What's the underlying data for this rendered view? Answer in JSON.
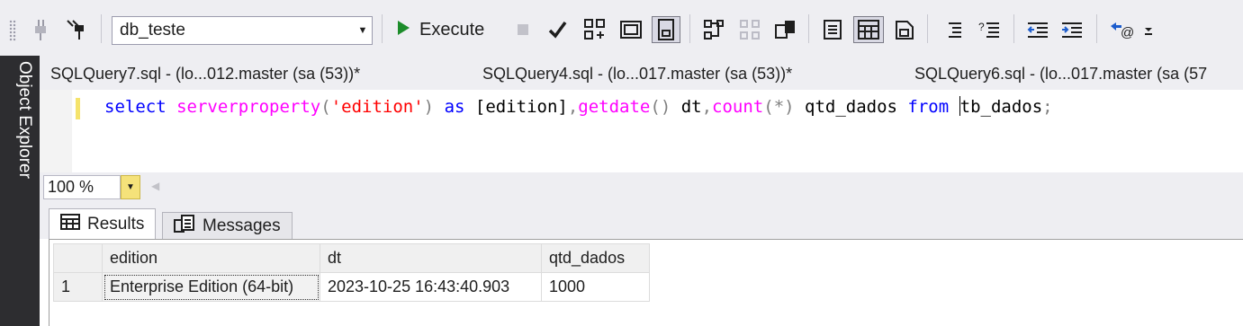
{
  "toolbar": {
    "database": "db_teste",
    "execute_label": "Execute"
  },
  "object_explorer": {
    "label": "Object Explorer"
  },
  "doc_tabs": [
    {
      "label": "SQLQuery7.sql - (lo...012.master (sa (53))*"
    },
    {
      "label": "SQLQuery4.sql - (lo...017.master (sa (53))*"
    },
    {
      "label": "SQLQuery6.sql - (lo...017.master (sa (57"
    }
  ],
  "editor": {
    "tokens": [
      {
        "t": "select",
        "c": "kw"
      },
      {
        "t": " ",
        "c": ""
      },
      {
        "t": "serverproperty",
        "c": "fn"
      },
      {
        "t": "(",
        "c": "op"
      },
      {
        "t": "'edition'",
        "c": "str"
      },
      {
        "t": ")",
        "c": "op"
      },
      {
        "t": " ",
        "c": ""
      },
      {
        "t": "as",
        "c": "kw"
      },
      {
        "t": " [edition]",
        "c": ""
      },
      {
        "t": ",",
        "c": "op"
      },
      {
        "t": "getdate",
        "c": "fn"
      },
      {
        "t": "()",
        "c": "op"
      },
      {
        "t": " dt",
        "c": ""
      },
      {
        "t": ",",
        "c": "op"
      },
      {
        "t": "count",
        "c": "fn"
      },
      {
        "t": "(*)",
        "c": "op"
      },
      {
        "t": " qtd_dados ",
        "c": ""
      },
      {
        "t": "from",
        "c": "kw"
      },
      {
        "t": " ",
        "c": ""
      },
      {
        "t": "|",
        "c": "caret"
      },
      {
        "t": "tb_dados",
        "c": ""
      },
      {
        "t": ";",
        "c": "op"
      }
    ]
  },
  "zoom": {
    "value": "100 %"
  },
  "results": {
    "tabs": {
      "results_label": "Results",
      "messages_label": "Messages"
    },
    "columns": [
      "edition",
      "dt",
      "qtd_dados"
    ],
    "rows": [
      {
        "num": "1",
        "cells": [
          "Enterprise Edition (64-bit)",
          "2023-10-25 16:43:40.903",
          "1000"
        ]
      }
    ]
  },
  "colors": {
    "keyword": "#0000ff",
    "function": "#ff00ff",
    "string": "#ff0000",
    "operator": "#808080",
    "side_panel": "#2d2d30",
    "toolbar_bg": "#eeeef2"
  }
}
